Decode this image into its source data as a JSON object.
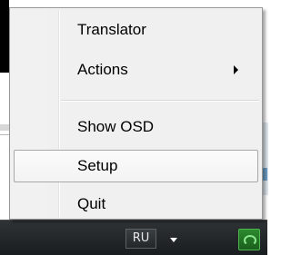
{
  "taskbar": {
    "language_indicator": "RU",
    "tray_arrow_icon": "triangle-up-icon",
    "tray_app_icon": "translator-tray-icon"
  },
  "menu": {
    "items": [
      {
        "label": "Translator"
      },
      {
        "label": "Actions",
        "has_submenu": true
      },
      {
        "label": "Show OSD"
      },
      {
        "label": "Setup",
        "highlighted": true
      },
      {
        "label": "Quit"
      }
    ]
  }
}
